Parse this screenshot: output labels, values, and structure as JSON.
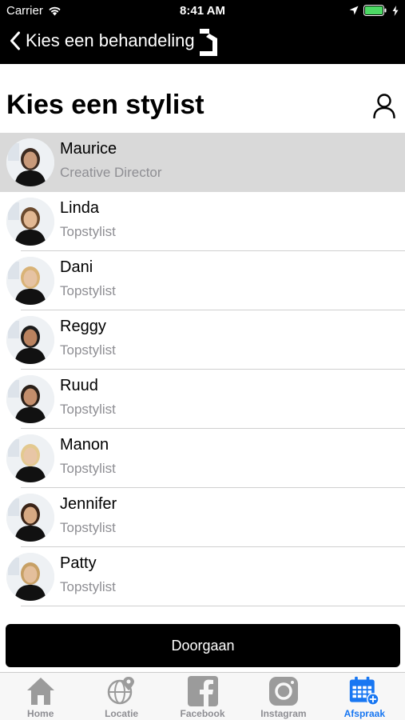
{
  "status_bar": {
    "carrier": "Carrier",
    "time": "8:41 AM"
  },
  "nav": {
    "back_label": "Kies een behandeling"
  },
  "page": {
    "title": "Kies een stylist"
  },
  "stylists": [
    {
      "name": "Maurice",
      "role": "Creative Director",
      "selected": true
    },
    {
      "name": "Linda",
      "role": "Topstylist",
      "selected": false
    },
    {
      "name": "Dani",
      "role": "Topstylist",
      "selected": false
    },
    {
      "name": "Reggy",
      "role": "Topstylist",
      "selected": false
    },
    {
      "name": "Ruud",
      "role": "Topstylist",
      "selected": false
    },
    {
      "name": "Manon",
      "role": "Topstylist",
      "selected": false
    },
    {
      "name": "Jennifer",
      "role": "Topstylist",
      "selected": false
    },
    {
      "name": "Patty",
      "role": "Topstylist",
      "selected": false
    }
  ],
  "continue_button": {
    "label": "Doorgaan"
  },
  "tab_bar": {
    "tabs": [
      {
        "label": "Home",
        "icon": "home-icon",
        "active": false
      },
      {
        "label": "Locatie",
        "icon": "globe-pin-icon",
        "active": false
      },
      {
        "label": "Facebook",
        "icon": "facebook-icon",
        "active": false
      },
      {
        "label": "Instagram",
        "icon": "instagram-icon",
        "active": false
      },
      {
        "label": "Afspraak",
        "icon": "calendar-add-icon",
        "active": true
      }
    ],
    "active_color": "#1877f2",
    "inactive_color": "#8e8e93"
  },
  "colors": {
    "header_bg": "#000000",
    "selected_row_bg": "#d9d9d9",
    "secondary_text": "#8e8e93"
  }
}
